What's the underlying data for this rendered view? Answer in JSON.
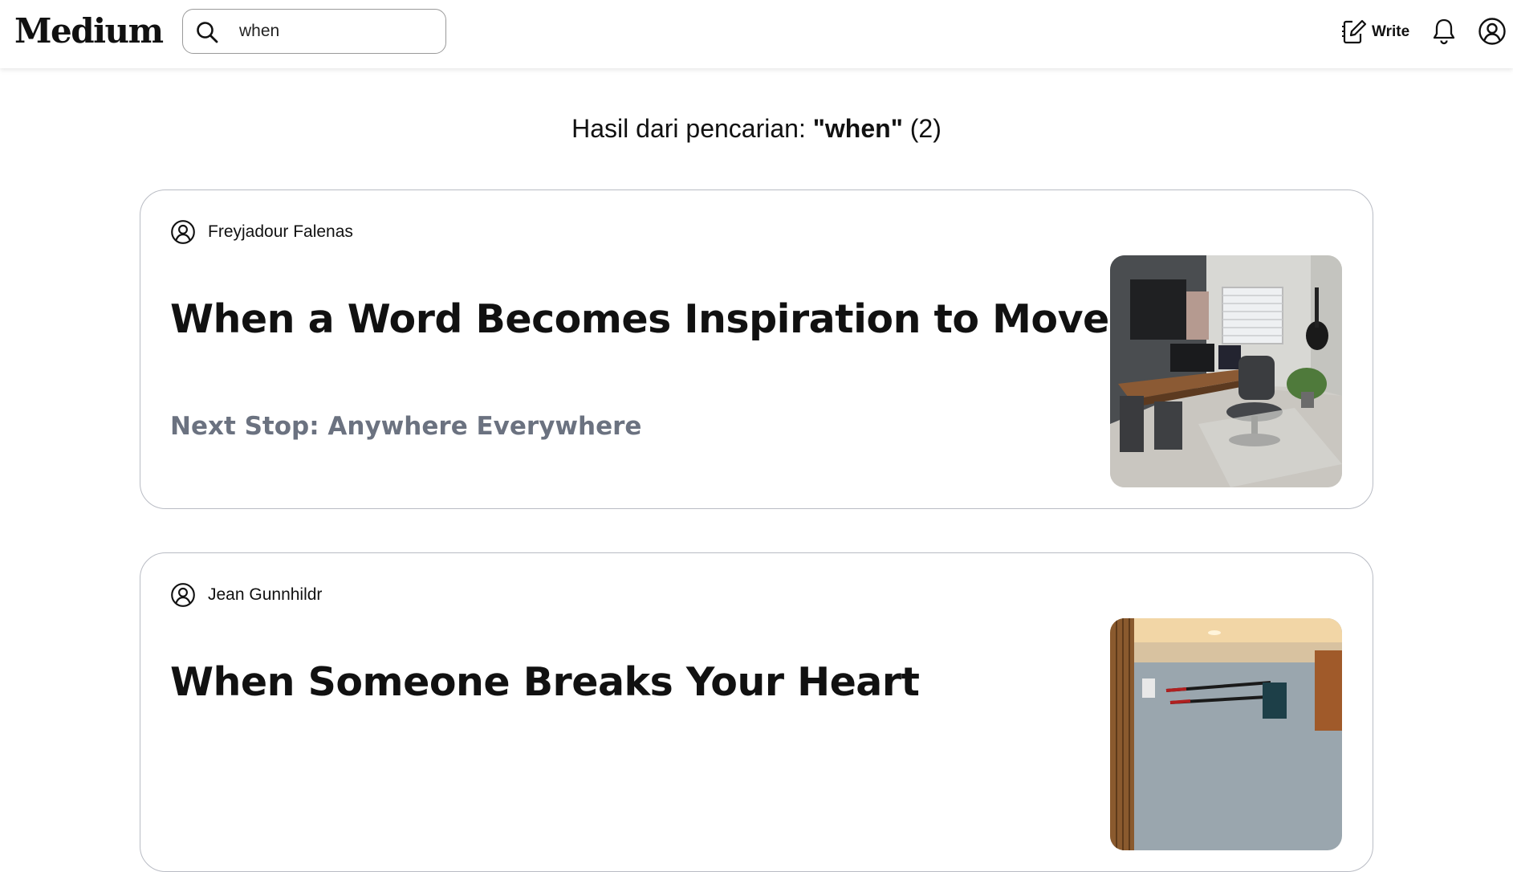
{
  "header": {
    "logo": "Medium",
    "search": {
      "value": "when",
      "placeholder": "Search"
    },
    "write_label": "Write"
  },
  "results": {
    "prefix": "Hasil dari pencarian: ",
    "query": "\"when\"",
    "count": " (2)"
  },
  "articles": [
    {
      "author": "Freyjadour Falenas",
      "title": "When a Word Becomes Inspiration to Move",
      "subtitle": "Next Stop: Anywhere Everywhere",
      "thumbnail": "home-office-photo"
    },
    {
      "author": "Jean Gunnhildr",
      "title": "When Someone Breaks Your Heart",
      "subtitle": "",
      "thumbnail": "interior-wall-photo"
    }
  ],
  "colors": {
    "text": "#111111",
    "subtitle": "#6b7280",
    "card_border": "#b9bcc4",
    "search_border": "#9a9a9a"
  }
}
